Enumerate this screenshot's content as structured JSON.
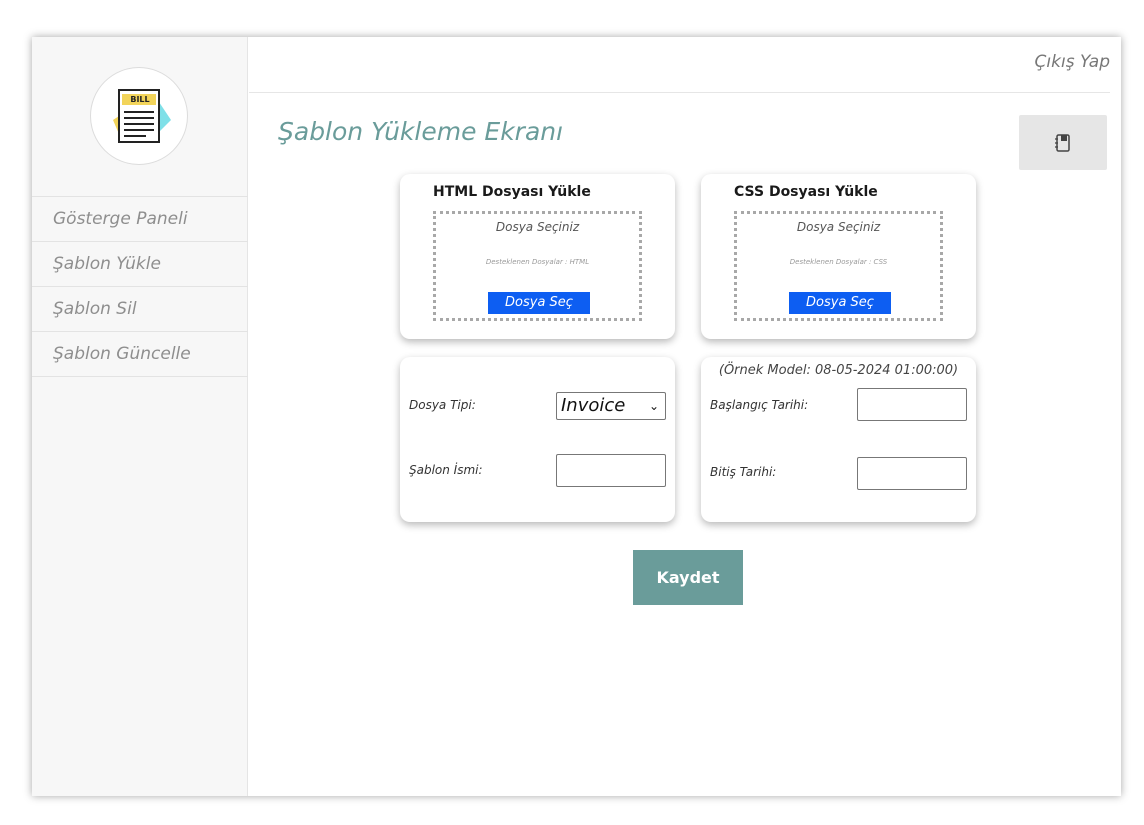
{
  "sidebar": {
    "logo_text": "BILL",
    "items": [
      {
        "label": "Gösterge Paneli"
      },
      {
        "label": "Şablon Yükle"
      },
      {
        "label": "Şablon Sil"
      },
      {
        "label": "Şablon Güncelle"
      }
    ]
  },
  "header": {
    "logout_label": "Çıkış Yap",
    "page_title": "Şablon Yükleme Ekranı",
    "icon_button": "notebook-icon"
  },
  "upload_html": {
    "title": "HTML Dosyası Yükle",
    "drop_label": "Dosya Seçiniz",
    "hint": "Desteklenen Dosyalar : HTML",
    "button_label": "Dosya Seç"
  },
  "upload_css": {
    "title": "CSS Dosyası Yükle",
    "drop_label": "Dosya Seçiniz",
    "hint": "Desteklenen Dosyalar : CSS",
    "button_label": "Dosya Seç"
  },
  "template_form": {
    "type_label": "Dosya Tipi:",
    "type_value": "Invoice",
    "name_label": "Şablon İsmi:",
    "name_value": ""
  },
  "date_form": {
    "example": "(Örnek Model: 08-05-2024 01:00:00)",
    "start_label": "Başlangıç Tarihi:",
    "start_value": "",
    "end_label": "Bitiş Tarihi:",
    "end_value": ""
  },
  "actions": {
    "save_label": "Kaydet"
  },
  "colors": {
    "accent": "#6a9c9a",
    "file_button": "#0d5ef2",
    "sidebar_bg": "#f7f7f7"
  }
}
